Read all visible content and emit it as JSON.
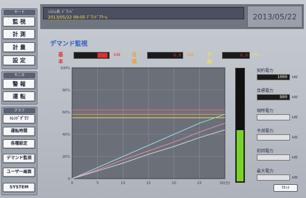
{
  "left_nav": {
    "group1_header": "モード",
    "group1": [
      "監 視",
      "計 測",
      "計 量",
      "設 定"
    ],
    "group2_header": "モニタ",
    "group2": [
      "警 報",
      "運 転"
    ],
    "group3_header": "グラフ",
    "group3": [
      "ﾄﾚﾝﾄﾞｸﾞﾗﾌ",
      "運転時間",
      "各種設定",
      "デマンド監視",
      "ユーザー画面",
      "SYSTEM"
    ]
  },
  "topbar": {
    "line1": "ｼｽﾃﾑ名     ﾃﾞﾏﾝﾄﾞ",
    "line2": "2013/05/22 09:05 ﾃﾞﾏﾝﾄﾞｱﾗｰﾑ",
    "date": "2013/05/22"
  },
  "page_title": "デマンド監視",
  "legend": [
    {
      "name": "基本",
      "value": "████",
      "unit": "kW",
      "color": "#e0303a"
    },
    {
      "name": "目標",
      "value": "0.0",
      "unit": "kW",
      "color": "#f0a020"
    },
    {
      "name": "予測",
      "value": "0.0",
      "unit": "kW",
      "color": "#e8e060"
    }
  ],
  "chart_data": {
    "type": "line",
    "x": [
      0,
      5,
      10,
      15,
      20,
      25,
      30
    ],
    "xticks": [
      "0",
      "5",
      "10",
      "15",
      "20",
      "25",
      "30(分)"
    ],
    "yticks": [
      "100%",
      "80%",
      "60%",
      "40%",
      "20%",
      "0"
    ],
    "ylim": [
      0,
      100
    ],
    "series": [
      {
        "values": [
          0,
          10,
          20,
          30,
          40,
          50,
          58
        ],
        "color": "#9fd6e8"
      },
      {
        "values": [
          0,
          8,
          17,
          25,
          33,
          42,
          50
        ],
        "color": "#e890a0"
      },
      {
        "values": [
          0,
          7,
          14,
          22,
          29,
          37,
          44
        ],
        "color": "#d8d8d8"
      }
    ],
    "hlines": [
      {
        "value": 62,
        "color": "#e07070"
      },
      {
        "value": 58,
        "color": "#f0a040"
      },
      {
        "value": 55,
        "color": "#e8e070"
      }
    ],
    "plot_bg": "#6a6f78",
    "grid": true
  },
  "bar_level": 0.45,
  "right_panel": {
    "items": [
      {
        "label": "契約電力",
        "value": "1000",
        "unit": "kW",
        "dark": true
      },
      {
        "label": "目標電力",
        "value": "800",
        "unit": "kW",
        "dark": true
      },
      {
        "label": "現時電力",
        "value": "",
        "unit": "kW",
        "dark": false
      },
      {
        "label": "予測電力",
        "value": "",
        "unit": "kW",
        "dark": false
      },
      {
        "label": "前回電力",
        "value": "",
        "unit": "kW",
        "dark": false
      },
      {
        "label": "最大電力",
        "value": "",
        "unit": "kW",
        "dark": false
      }
    ],
    "reset": "ﾘｾｯﾄ"
  }
}
